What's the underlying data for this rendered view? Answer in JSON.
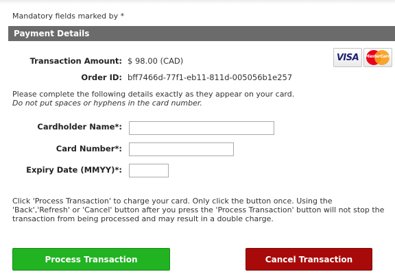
{
  "mandatory_note": "Mandatory fields marked by *",
  "section": {
    "title": "Payment Details"
  },
  "transaction": {
    "amount_label": "Transaction Amount:",
    "amount_value": "$ 98.00 (CAD)",
    "order_label": "Order ID:",
    "order_value": "bff7466d-77f1-eb11-811d-005056b1e257"
  },
  "card_logos": {
    "visa": "VISA",
    "mastercard": "MasterCard"
  },
  "instructions": {
    "line1": "Please complete the following details exactly as they appear on your card.",
    "line2": "Do not put spaces or hyphens in the card number."
  },
  "form": {
    "cardholder_label": "Cardholder Name*:",
    "cardholder_value": "",
    "card_number_label": "Card Number*:",
    "card_number_value": "",
    "expiry_label": "Expiry Date (MMYY)*:",
    "expiry_value": ""
  },
  "notice": {
    "line1": "Click 'Process Transaction' to charge your card. Only click the button once. Using the",
    "line2": "'Back','Refresh' or 'Cancel' button after you press the 'Process Transaction' button will not stop the",
    "line3": "transaction from being processed and may result in a double charge."
  },
  "buttons": {
    "process_label": "Process Transaction",
    "cancel_label": "Cancel Transaction"
  },
  "colors": {
    "section_header_bg": "#6b6b6b",
    "process_button": "#22b322",
    "cancel_button": "#a80a0a"
  }
}
